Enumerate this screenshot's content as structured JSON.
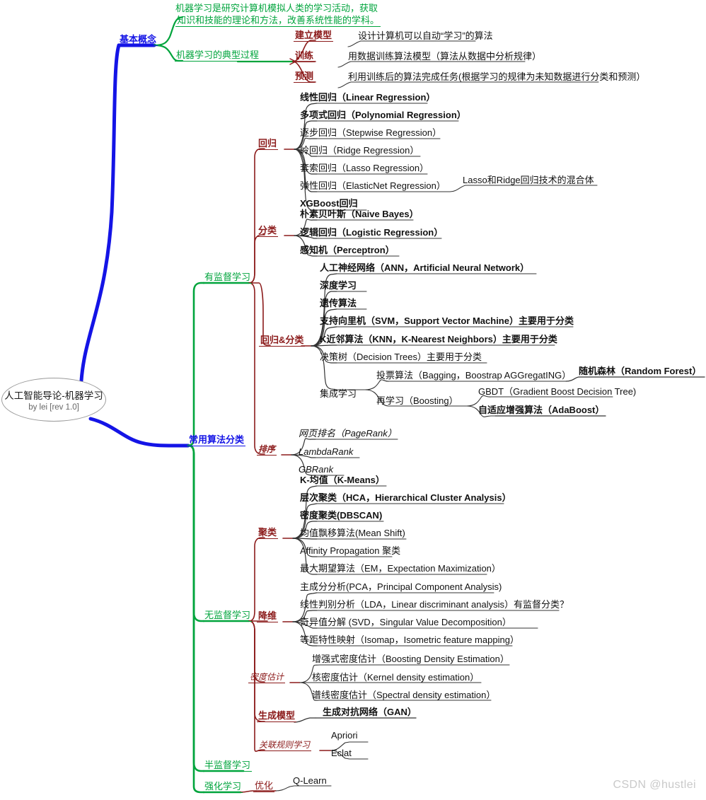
{
  "meta": {
    "watermark": "CSDN @hustlei",
    "colors": {
      "green": "#00a43c",
      "blue": "#1414e6",
      "dark_red": "#8b1a1a",
      "black": "#111111",
      "root_border": "#9a9a9a",
      "watermark": "#c9c9c9"
    }
  },
  "root": {
    "title": "人工智能导论-机器学习",
    "subtitle": "by lei [rev 1.0]"
  },
  "branches": {
    "basic_concepts": {
      "label": "基本概念",
      "definition_line1": "机器学习是研究计算机模拟人类的学习活动，获取",
      "definition_line2": "知识和技能的理论和方法，改善系统性能的学科。",
      "process": {
        "label": "机器学习的典型过程",
        "steps": [
          {
            "label": "建立模型",
            "desc": "设计计算机可以自动“学习”的算法"
          },
          {
            "label": "训练",
            "desc": "用数据训练算法模型（算法从数据中分析规律）"
          },
          {
            "label": "预测",
            "desc": "利用训练后的算法完成任务(根据学习的规律为未知数据进行分类和预测）"
          }
        ]
      }
    },
    "algorithms": {
      "label": "常用算法分类",
      "supervised": {
        "label": "有监督学习",
        "groups": [
          {
            "label": "回归",
            "items": [
              {
                "text": "线性回归（Linear Regression）",
                "bold": true
              },
              {
                "text": "多项式回归（Polynomial Regression）",
                "bold": true
              },
              {
                "text": "逐步回归（Stepwise Regression）",
                "bold": false
              },
              {
                "text": "岭回归（Ridge Regression）",
                "bold": false
              },
              {
                "text": "套索回归（Lasso Regression）",
                "bold": false
              },
              {
                "text": "弹性回归（ElasticNet Regression）",
                "bold": false,
                "note": "Lasso和Ridge回归技术的混合体"
              },
              {
                "text": "XGBoost回归",
                "bold": true
              }
            ]
          },
          {
            "label": "分类",
            "items": [
              {
                "text": "朴素贝叶斯（Naive Bayes）",
                "bold": true
              },
              {
                "text": "逻辑回归（Logistic Regression）",
                "bold": true
              },
              {
                "text": "感知机（Perceptron）",
                "bold": true
              }
            ]
          },
          {
            "label": "回归&分类",
            "items": [
              {
                "text": "人工神经网络（ANN，Artificial Neural Network）",
                "bold": true
              },
              {
                "text": "深度学习",
                "bold": true
              },
              {
                "text": "遗传算法",
                "bold": true
              },
              {
                "text": "支持向里机（SVM，Support Vector Machine）主要用于分类",
                "bold": true
              },
              {
                "text": "K近邻算法（KNN，K-Nearest Neighbors）主要用于分类",
                "bold": true
              },
              {
                "text": "决策树（Decision Trees）主要用于分类",
                "bold": false
              }
            ],
            "ensemble": {
              "label": "集成学习",
              "children": [
                {
                  "text": "投票算法（Bagging，Boostrap AGGregatING）",
                  "bold": false,
                  "child": {
                    "text": "随机森林（Random Forest）",
                    "bold": true
                  }
                },
                {
                  "text": "再学习（Boosting）",
                  "bold": false,
                  "children": [
                    {
                      "text": "GBDT（Gradient Boost Decision Tree)",
                      "bold": false
                    },
                    {
                      "text": "自适应增强算法（AdaBoost）",
                      "bold": true
                    }
                  ]
                }
              ]
            }
          },
          {
            "label": "排序",
            "italic": true,
            "items": [
              {
                "text": "网页排名（PageRank）",
                "italic": true
              },
              {
                "text": "LambdaRank",
                "italic": true
              },
              {
                "text": "GBRank",
                "italic": true
              }
            ]
          }
        ]
      },
      "unsupervised": {
        "label": "无监督学习",
        "groups": [
          {
            "label": "聚类",
            "items": [
              {
                "text": "K-均值（K-Means）",
                "bold": true
              },
              {
                "text": "层次聚类（HCA，Hierarchical Cluster Analysis）",
                "bold": true
              },
              {
                "text": "密度聚类(DBSCAN)",
                "bold": true
              },
              {
                "text": "均值飘移算法(Mean Shift)",
                "bold": false
              },
              {
                "text": "Affinity Propagation 聚类",
                "bold": false
              },
              {
                "text": "最大期望算法（EM，Expectation Maximization）",
                "bold": false
              }
            ]
          },
          {
            "label": "降维",
            "items": [
              {
                "text": "主成分分析(PCA，Principal Component Analysis)",
                "bold": false
              },
              {
                "text": "线性判别分析（LDA，Linear discriminant analysis）有监督分类？",
                "bold": false
              },
              {
                "text": "奇异值分解 (SVD，Singular Value Decomposition）",
                "bold": false
              },
              {
                "text": "等距特性映射（Isomap，Isometric feature mapping）",
                "bold": false
              }
            ]
          },
          {
            "label": "密度估计",
            "italic": true,
            "items": [
              {
                "text": "增强式密度估计（Boosting Density Estimation）",
                "bold": false
              },
              {
                "text": "核密度估计（Kernel density estimation）",
                "bold": false
              },
              {
                "text": "谱线密度估计（Spectral density estimation）",
                "bold": false
              }
            ]
          },
          {
            "label": "生成模型",
            "bold": true,
            "items": [
              {
                "text": "生成对抗网络（GAN）",
                "bold": true
              }
            ]
          },
          {
            "label": "关联规则学习",
            "italic": true,
            "items": [
              {
                "text": "Apriori",
                "bold": false
              },
              {
                "text": "Eclat",
                "bold": false
              }
            ]
          }
        ]
      },
      "semi_supervised": {
        "label": "半监督学习"
      },
      "reinforcement": {
        "label": "强化学习",
        "groups": [
          {
            "label": "优化",
            "items": [
              {
                "text": "Q-Learn",
                "bold": false
              }
            ]
          }
        ]
      }
    }
  }
}
